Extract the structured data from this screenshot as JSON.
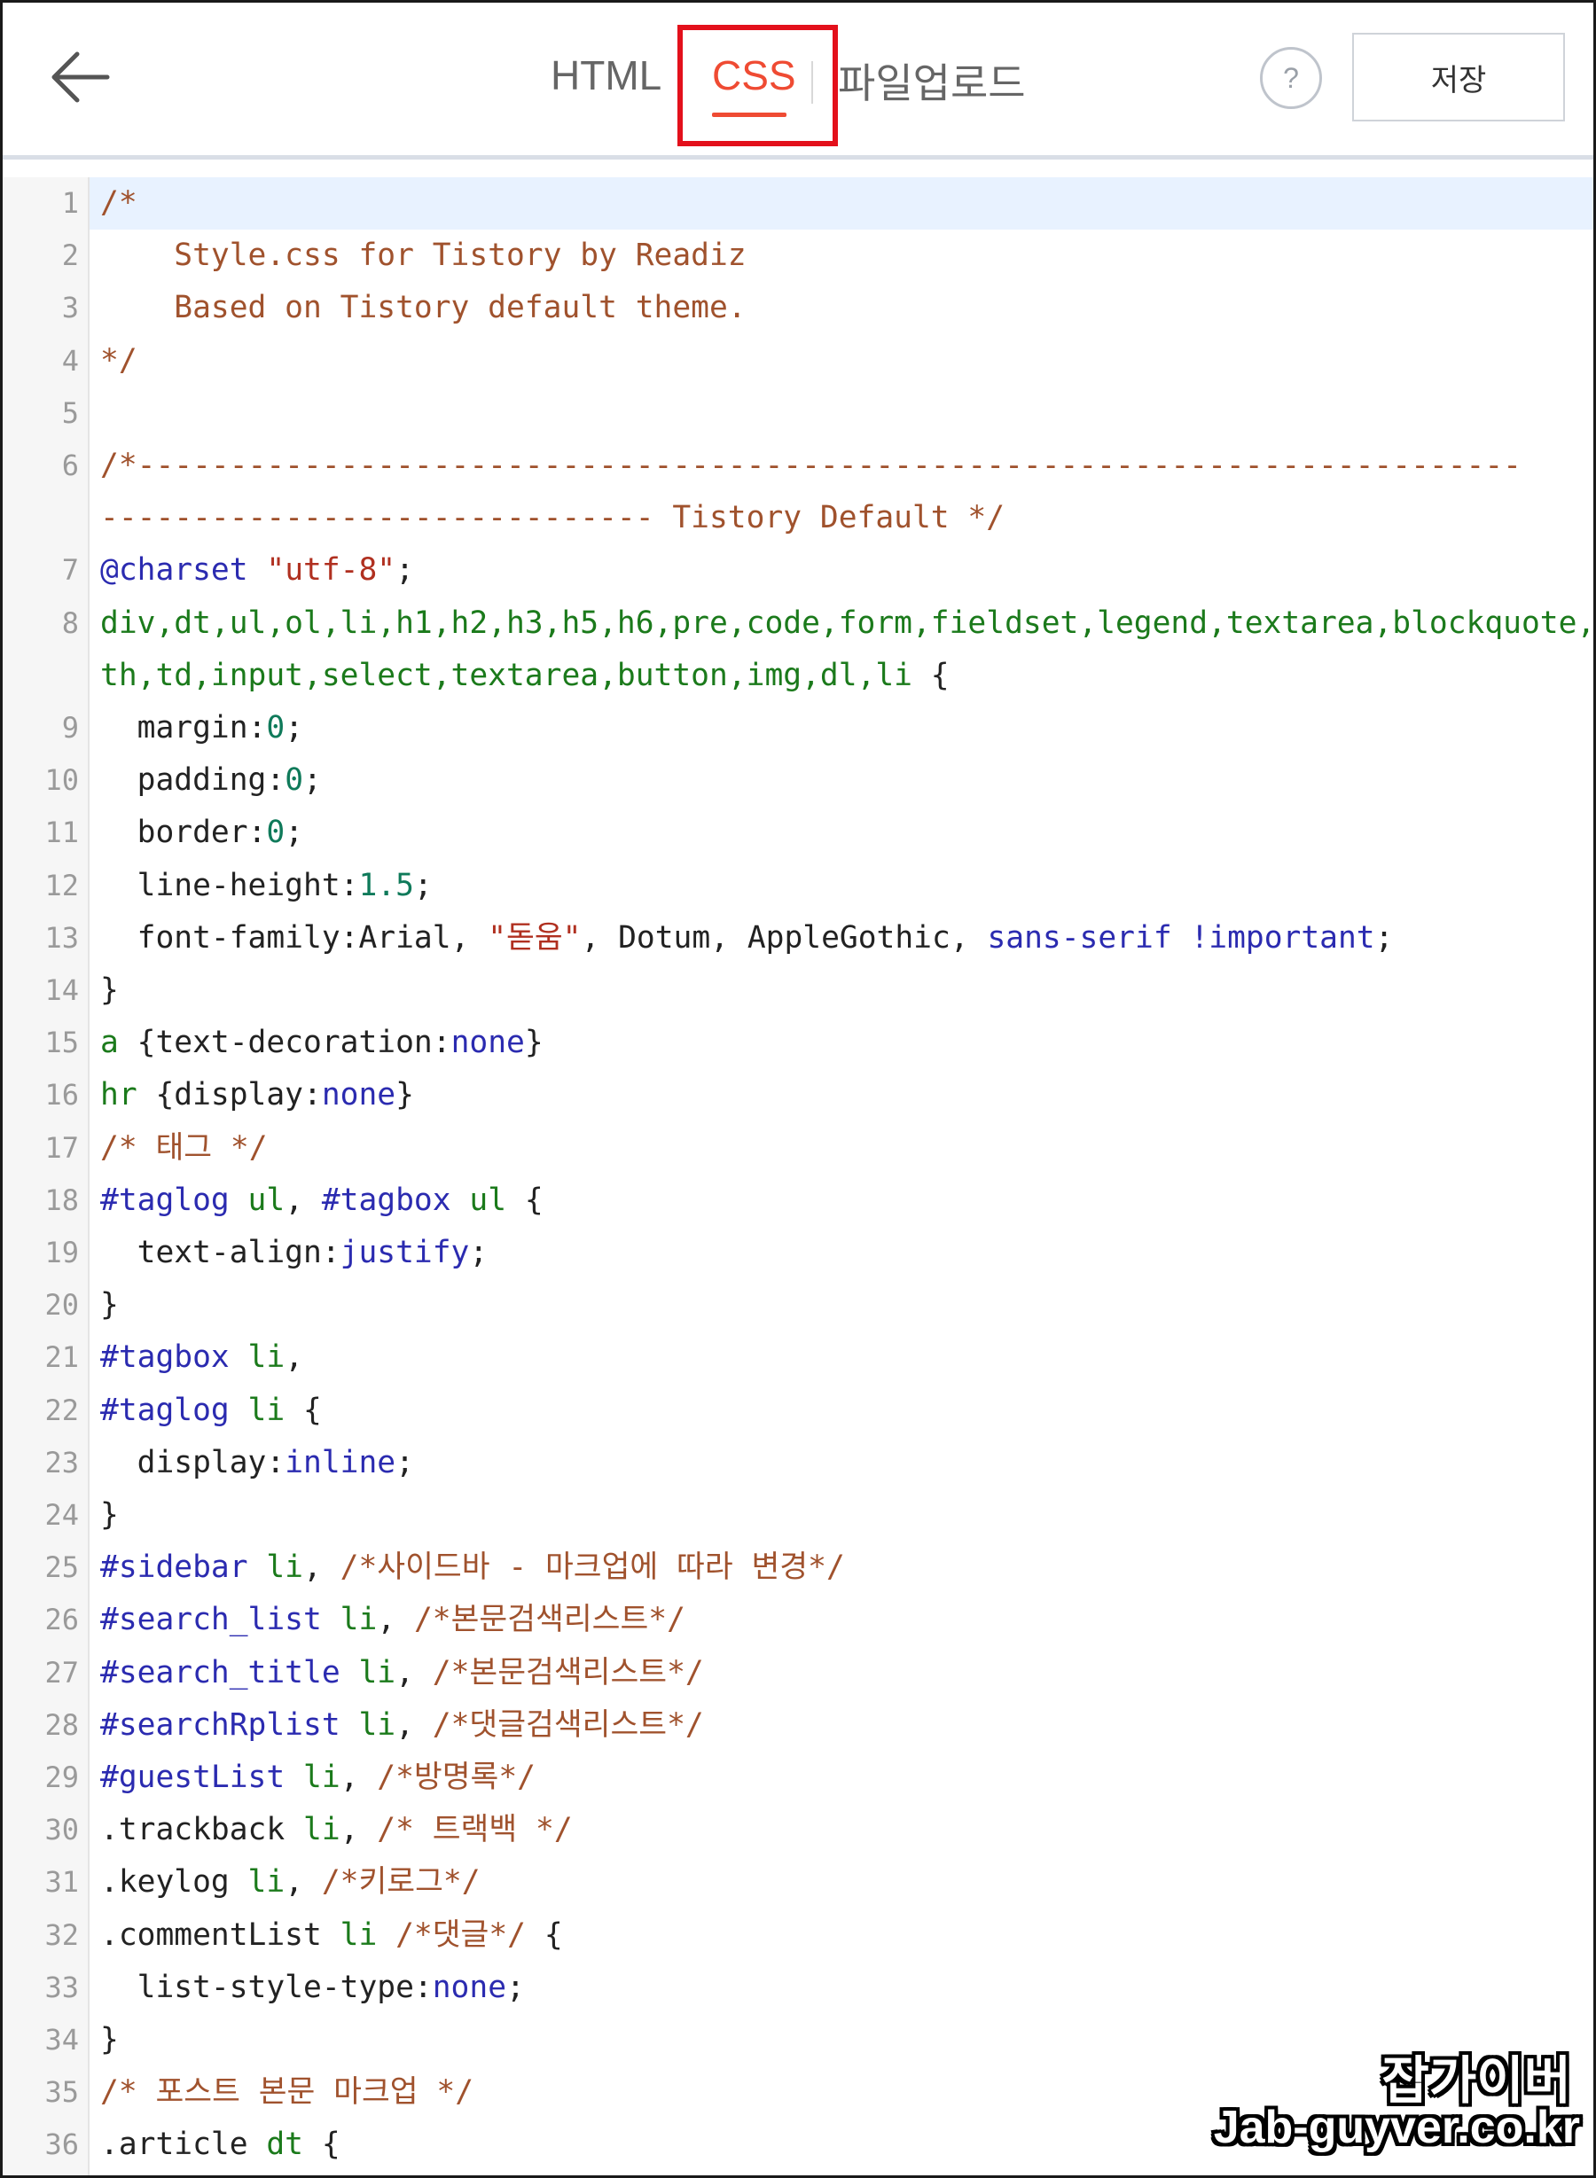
{
  "header": {
    "tabs": [
      "HTML",
      "CSS",
      "파일업로드"
    ],
    "active_tab": "CSS",
    "help_label": "?",
    "save_label": "저장",
    "colors": {
      "active": "#ef4b33",
      "highlight_box": "#e3101b"
    }
  },
  "editor": {
    "lines": [
      {
        "n": "1",
        "segs": [
          [
            "c",
            "/*"
          ]
        ]
      },
      {
        "n": "2",
        "segs": [
          [
            "c",
            "    Style.css for Tistory by Readiz"
          ]
        ]
      },
      {
        "n": "3",
        "segs": [
          [
            "c",
            "    Based on Tistory default theme."
          ]
        ]
      },
      {
        "n": "4",
        "segs": [
          [
            "c",
            "*/"
          ]
        ]
      },
      {
        "n": "5",
        "segs": []
      },
      {
        "n": "6",
        "segs": [
          [
            "c",
            "/*---------------------------------------------------------------------------"
          ]
        ]
      },
      {
        "n": "",
        "segs": [
          [
            "c",
            "------------------------------ Tistory Default */"
          ]
        ]
      },
      {
        "n": "7",
        "segs": [
          [
            "k",
            "@charset"
          ],
          [
            "p",
            " "
          ],
          [
            "s",
            "\"utf-8\""
          ],
          [
            "p",
            ";"
          ]
        ]
      },
      {
        "n": "8",
        "segs": [
          [
            "t",
            "div,dt,ul,ol,li,h1,h2,h3,h5,h6,pre,code,form,fieldset,legend,textarea,blockquote,"
          ]
        ]
      },
      {
        "n": "",
        "segs": [
          [
            "t",
            "th,td,input,select,textarea,button,img,dl,li"
          ],
          [
            "p",
            " {"
          ]
        ]
      },
      {
        "n": "9",
        "segs": [
          [
            "p",
            "  margin:"
          ],
          [
            "n",
            "0"
          ],
          [
            "p",
            ";"
          ]
        ]
      },
      {
        "n": "10",
        "segs": [
          [
            "p",
            "  padding:"
          ],
          [
            "n",
            "0"
          ],
          [
            "p",
            ";"
          ]
        ]
      },
      {
        "n": "11",
        "segs": [
          [
            "p",
            "  border:"
          ],
          [
            "n",
            "0"
          ],
          [
            "p",
            ";"
          ]
        ]
      },
      {
        "n": "12",
        "segs": [
          [
            "p",
            "  line-height:"
          ],
          [
            "n",
            "1.5"
          ],
          [
            "p",
            ";"
          ]
        ]
      },
      {
        "n": "13",
        "segs": [
          [
            "p",
            "  font-family:Arial, "
          ],
          [
            "s",
            "\"돋움\""
          ],
          [
            "p",
            ", Dotum, AppleGothic, "
          ],
          [
            "k",
            "sans-serif !important"
          ],
          [
            "p",
            ";"
          ]
        ]
      },
      {
        "n": "14",
        "segs": [
          [
            "p",
            "}"
          ]
        ]
      },
      {
        "n": "15",
        "segs": [
          [
            "t",
            "a"
          ],
          [
            "p",
            " {text-decoration:"
          ],
          [
            "k",
            "none"
          ],
          [
            "p",
            "}"
          ]
        ]
      },
      {
        "n": "16",
        "segs": [
          [
            "t",
            "hr"
          ],
          [
            "p",
            " {display:"
          ],
          [
            "k",
            "none"
          ],
          [
            "p",
            "}"
          ]
        ]
      },
      {
        "n": "17",
        "segs": [
          [
            "c",
            "/* 태그 */"
          ]
        ]
      },
      {
        "n": "18",
        "segs": [
          [
            "k",
            "#taglog"
          ],
          [
            "t",
            " ul"
          ],
          [
            "p",
            ", "
          ],
          [
            "k",
            "#tagbox"
          ],
          [
            "t",
            " ul"
          ],
          [
            "p",
            " {"
          ]
        ]
      },
      {
        "n": "19",
        "segs": [
          [
            "p",
            "  text-align:"
          ],
          [
            "k",
            "justify"
          ],
          [
            "p",
            ";"
          ]
        ]
      },
      {
        "n": "20",
        "segs": [
          [
            "p",
            "}"
          ]
        ]
      },
      {
        "n": "21",
        "segs": [
          [
            "k",
            "#tagbox"
          ],
          [
            "t",
            " li"
          ],
          [
            "p",
            ","
          ]
        ]
      },
      {
        "n": "22",
        "segs": [
          [
            "k",
            "#taglog"
          ],
          [
            "t",
            " li"
          ],
          [
            "p",
            " {"
          ]
        ]
      },
      {
        "n": "23",
        "segs": [
          [
            "p",
            "  display:"
          ],
          [
            "k",
            "inline"
          ],
          [
            "p",
            ";"
          ]
        ]
      },
      {
        "n": "24",
        "segs": [
          [
            "p",
            "}"
          ]
        ]
      },
      {
        "n": "25",
        "segs": [
          [
            "k",
            "#sidebar"
          ],
          [
            "t",
            " li"
          ],
          [
            "p",
            ", "
          ],
          [
            "c",
            "/*사이드바 - 마크업에 따라 변경*/"
          ]
        ]
      },
      {
        "n": "26",
        "segs": [
          [
            "k",
            "#search_list"
          ],
          [
            "t",
            " li"
          ],
          [
            "p",
            ", "
          ],
          [
            "c",
            "/*본문검색리스트*/"
          ]
        ]
      },
      {
        "n": "27",
        "segs": [
          [
            "k",
            "#search_title"
          ],
          [
            "t",
            " li"
          ],
          [
            "p",
            ", "
          ],
          [
            "c",
            "/*본문검색리스트*/"
          ]
        ]
      },
      {
        "n": "28",
        "segs": [
          [
            "k",
            "#searchRplist"
          ],
          [
            "t",
            " li"
          ],
          [
            "p",
            ", "
          ],
          [
            "c",
            "/*댓글검색리스트*/"
          ]
        ]
      },
      {
        "n": "29",
        "segs": [
          [
            "k",
            "#guestList"
          ],
          [
            "t",
            " li"
          ],
          [
            "p",
            ", "
          ],
          [
            "c",
            "/*방명록*/"
          ]
        ]
      },
      {
        "n": "30",
        "segs": [
          [
            "p",
            ".trackback"
          ],
          [
            "t",
            " li"
          ],
          [
            "p",
            ", "
          ],
          [
            "c",
            "/* 트랙백 */"
          ]
        ]
      },
      {
        "n": "31",
        "segs": [
          [
            "p",
            ".keylog"
          ],
          [
            "t",
            " li"
          ],
          [
            "p",
            ", "
          ],
          [
            "c",
            "/*키로그*/"
          ]
        ]
      },
      {
        "n": "32",
        "segs": [
          [
            "p",
            ".commentList"
          ],
          [
            "t",
            " li "
          ],
          [
            "c",
            "/*댓글*/"
          ],
          [
            "p",
            " {"
          ]
        ]
      },
      {
        "n": "33",
        "segs": [
          [
            "p",
            "  list-style-type:"
          ],
          [
            "k",
            "none"
          ],
          [
            "p",
            ";"
          ]
        ]
      },
      {
        "n": "34",
        "segs": [
          [
            "p",
            "}"
          ]
        ]
      },
      {
        "n": "35",
        "segs": [
          [
            "c",
            "/* 포스트 본문 마크업 */"
          ]
        ]
      },
      {
        "n": "36",
        "segs": [
          [
            "p",
            ".article"
          ],
          [
            "t",
            " dt"
          ],
          [
            "p",
            " {"
          ]
        ]
      }
    ]
  },
  "watermark": {
    "ko": "잡가이버",
    "en": "Jab-guyver.co.kr"
  }
}
